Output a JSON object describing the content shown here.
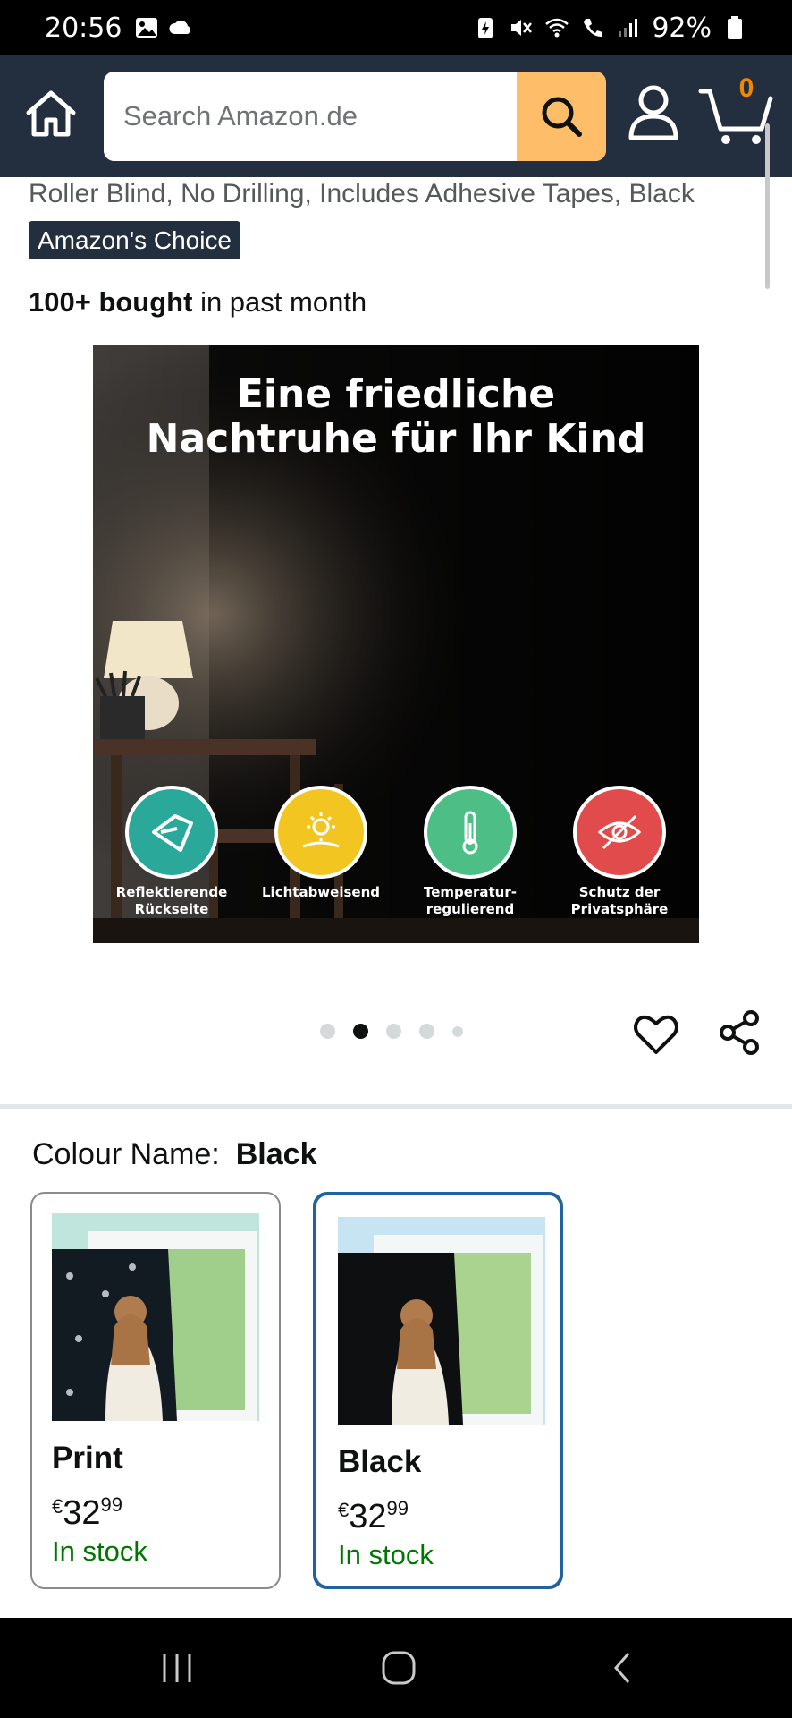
{
  "status_bar": {
    "time": "20:56",
    "battery": "92%"
  },
  "header": {
    "search_placeholder": "Search Amazon.de",
    "cart_count": "0",
    "colors": {
      "background": "#232f3e",
      "search_button": "#febd69",
      "cart_count": "#f08804"
    }
  },
  "product": {
    "title": "Roller Blind, No Drilling, Includes Adhesive Tapes, Black",
    "badge": "Amazon's Choice",
    "bought_bold": "100+ bought",
    "bought_rest": " in past month"
  },
  "gallery": {
    "headline_line1": "Eine friedliche",
    "headline_line2": "Nachtruhe für Ihr Kind",
    "features": [
      {
        "icon": "reflective-back-icon",
        "label_line1": "Reflektierende",
        "label_line2": "Rückseite",
        "color": "#2aa99a"
      },
      {
        "icon": "sun-block-icon",
        "label_line1": "Lichtabweisend",
        "label_line2": "",
        "color": "#f2c521"
      },
      {
        "icon": "thermometer-icon",
        "label_line1": "Temperatur-",
        "label_line2": "regulierend",
        "color": "#4dbf86"
      },
      {
        "icon": "privacy-eye-off-icon",
        "label_line1": "Schutz der",
        "label_line2": "Privatsphäre",
        "color": "#e24b4b"
      }
    ],
    "dot_count": 5,
    "active_dot": 2
  },
  "variation": {
    "label": "Colour Name:",
    "selected_value": "Black",
    "options": [
      {
        "name": "Print",
        "price_symbol": "€",
        "price_whole": "32",
        "price_fraction": "99",
        "stock": "In stock",
        "selected": false
      },
      {
        "name": "Black",
        "price_symbol": "€",
        "price_whole": "32",
        "price_fraction": "99",
        "stock": "In stock",
        "selected": true
      }
    ]
  }
}
